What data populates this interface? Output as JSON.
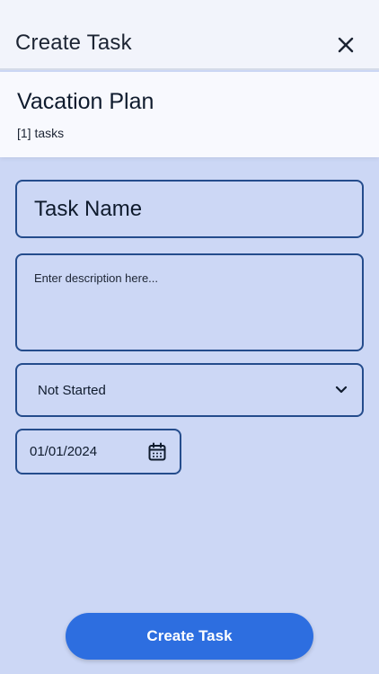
{
  "header": {
    "title": "Create Task",
    "close_icon": "close-icon"
  },
  "plan": {
    "title": "Vacation Plan",
    "count": "[1] tasks"
  },
  "form": {
    "task_name_placeholder": "Task Name",
    "description_placeholder": "Enter description here...",
    "status_value": "Not Started",
    "date_value": "01/01/2024"
  },
  "actions": {
    "create_label": "Create Task"
  },
  "colors": {
    "background": "#ccd7f5",
    "accent": "#2d6ee0",
    "border": "#244c8c"
  }
}
